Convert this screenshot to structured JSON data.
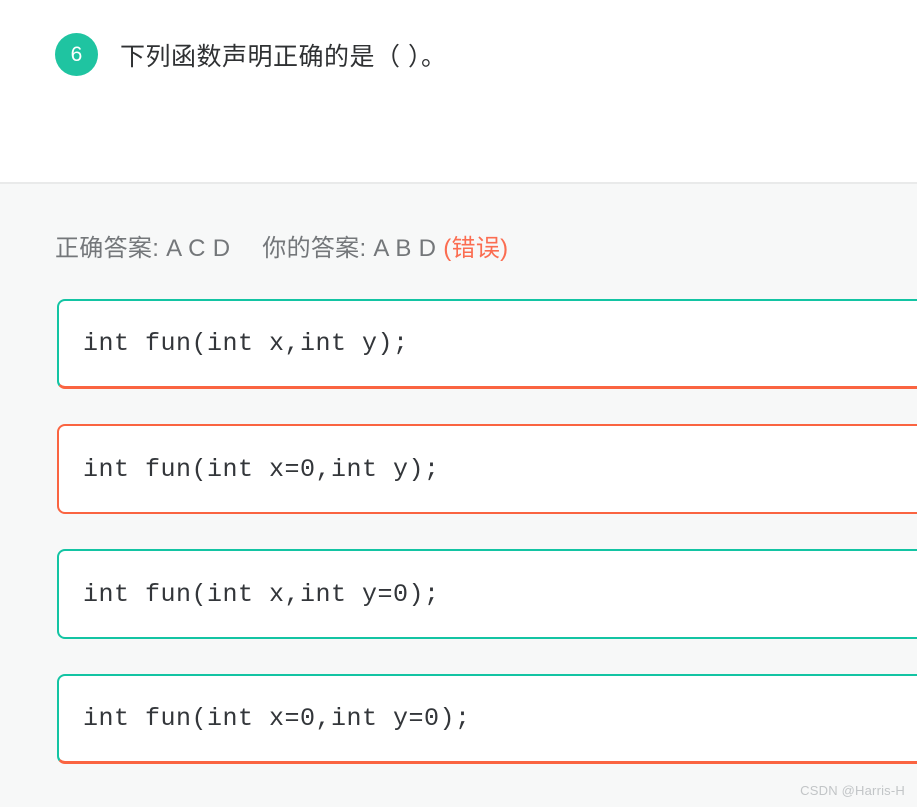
{
  "question": {
    "number": "6",
    "text": "下列函数声明正确的是（ ）。"
  },
  "result": {
    "correct_label": "正确答案:",
    "correct_value": "A C D",
    "your_label": "你的答案:",
    "your_value": "A B D",
    "verdict": "(错误)",
    "verdict_color": "#fb6d51"
  },
  "options": [
    {
      "code": "int fun(int x,int y);",
      "state": "correct-underline"
    },
    {
      "code": "int fun(int x=0,int y);",
      "state": "wrong"
    },
    {
      "code": "int fun(int x,int y=0);",
      "state": "correct"
    },
    {
      "code": "int fun(int x=0,int y=0);",
      "state": "correct-underline"
    }
  ],
  "colors": {
    "accent_teal": "#13c4a3",
    "accent_orange": "#fa6441",
    "badge_teal": "#1fc4a1",
    "body_background": "#f7f8f8",
    "header_background": "#ffffff",
    "text_primary": "#2f3133",
    "text_secondary": "#74777a",
    "code_text": "#33363a"
  },
  "watermark": {
    "text": "CSDN @Harris-H"
  }
}
